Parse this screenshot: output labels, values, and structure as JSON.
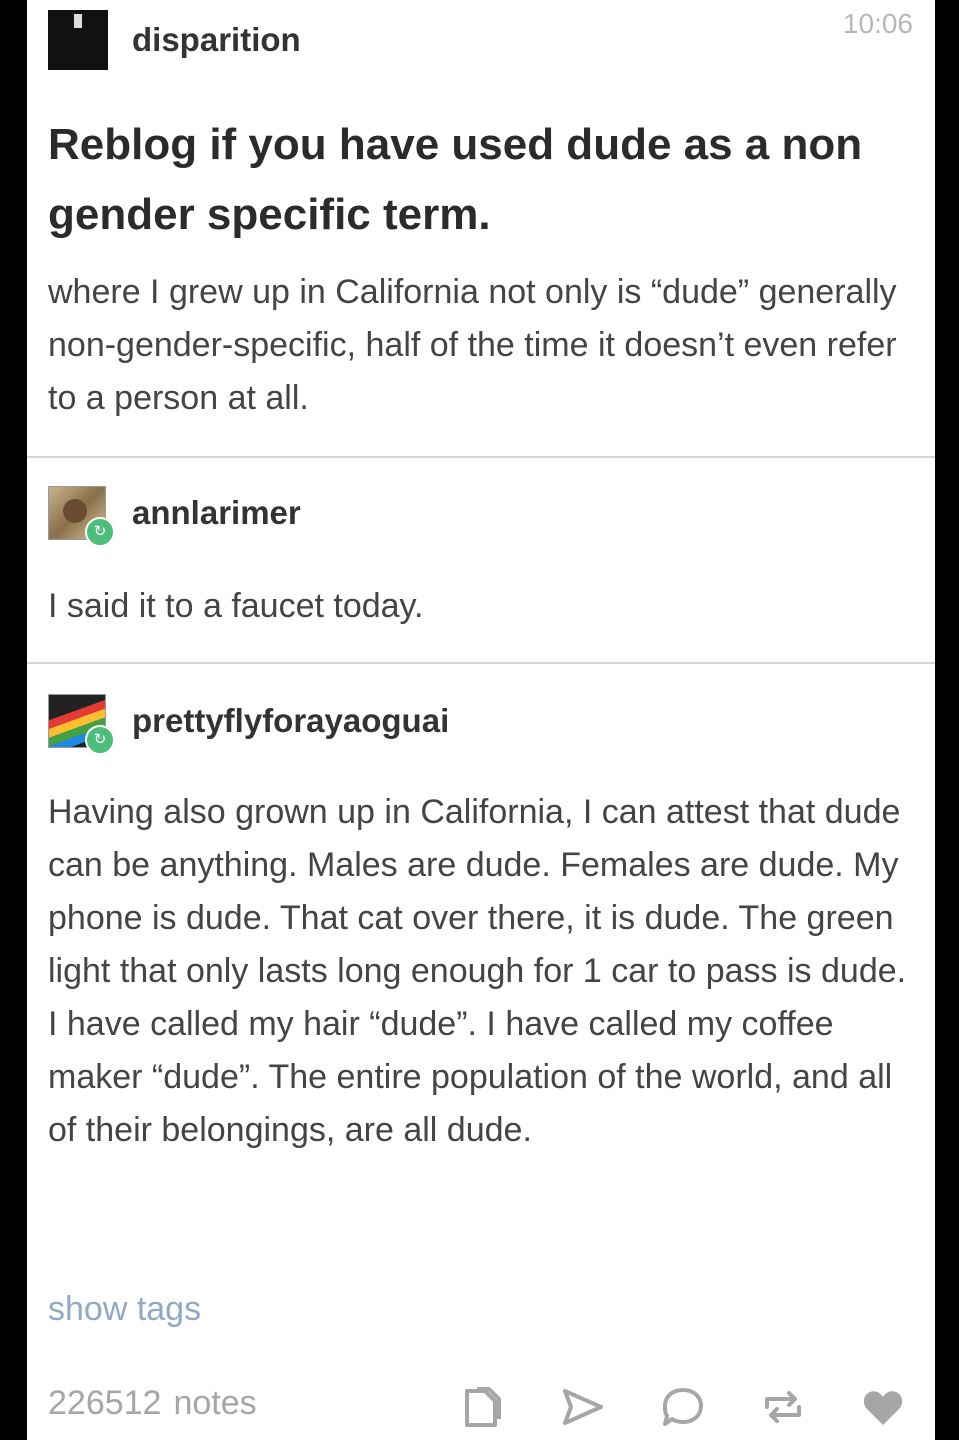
{
  "timestamp": "10:06",
  "post": {
    "author": "disparition",
    "title": "Reblog if you have used dude as a non gender specific term.",
    "body": "where I grew up in California not only is “dude” generally non-gender-specific, half of the time it doesn’t even refer to a person at all."
  },
  "reblogs": [
    {
      "author": "annlarimer",
      "text": "I said it to a faucet today."
    },
    {
      "author": "prettyflyforayaoguai",
      "text": "Having also grown up in California, I can attest that dude can be anything. Males are dude. Females are dude. My phone is dude. That cat over there, it is dude. The green light that only lasts long enough for 1 car to pass is dude. I have called my hair “dude”. I have called my coffee maker “dude”. The entire population of the world, and all of their belongings, are all dude."
    }
  ],
  "show_tags": "show tags",
  "footer": {
    "notes_count": "226512",
    "notes_label": "notes",
    "actions": [
      "copy-icon",
      "share-icon",
      "reply-icon",
      "reblog-icon",
      "like-icon"
    ]
  },
  "colors": {
    "link": "#8fa9c6",
    "muted": "#a6a6a6",
    "reblog_badge": "#4bbf7a"
  }
}
